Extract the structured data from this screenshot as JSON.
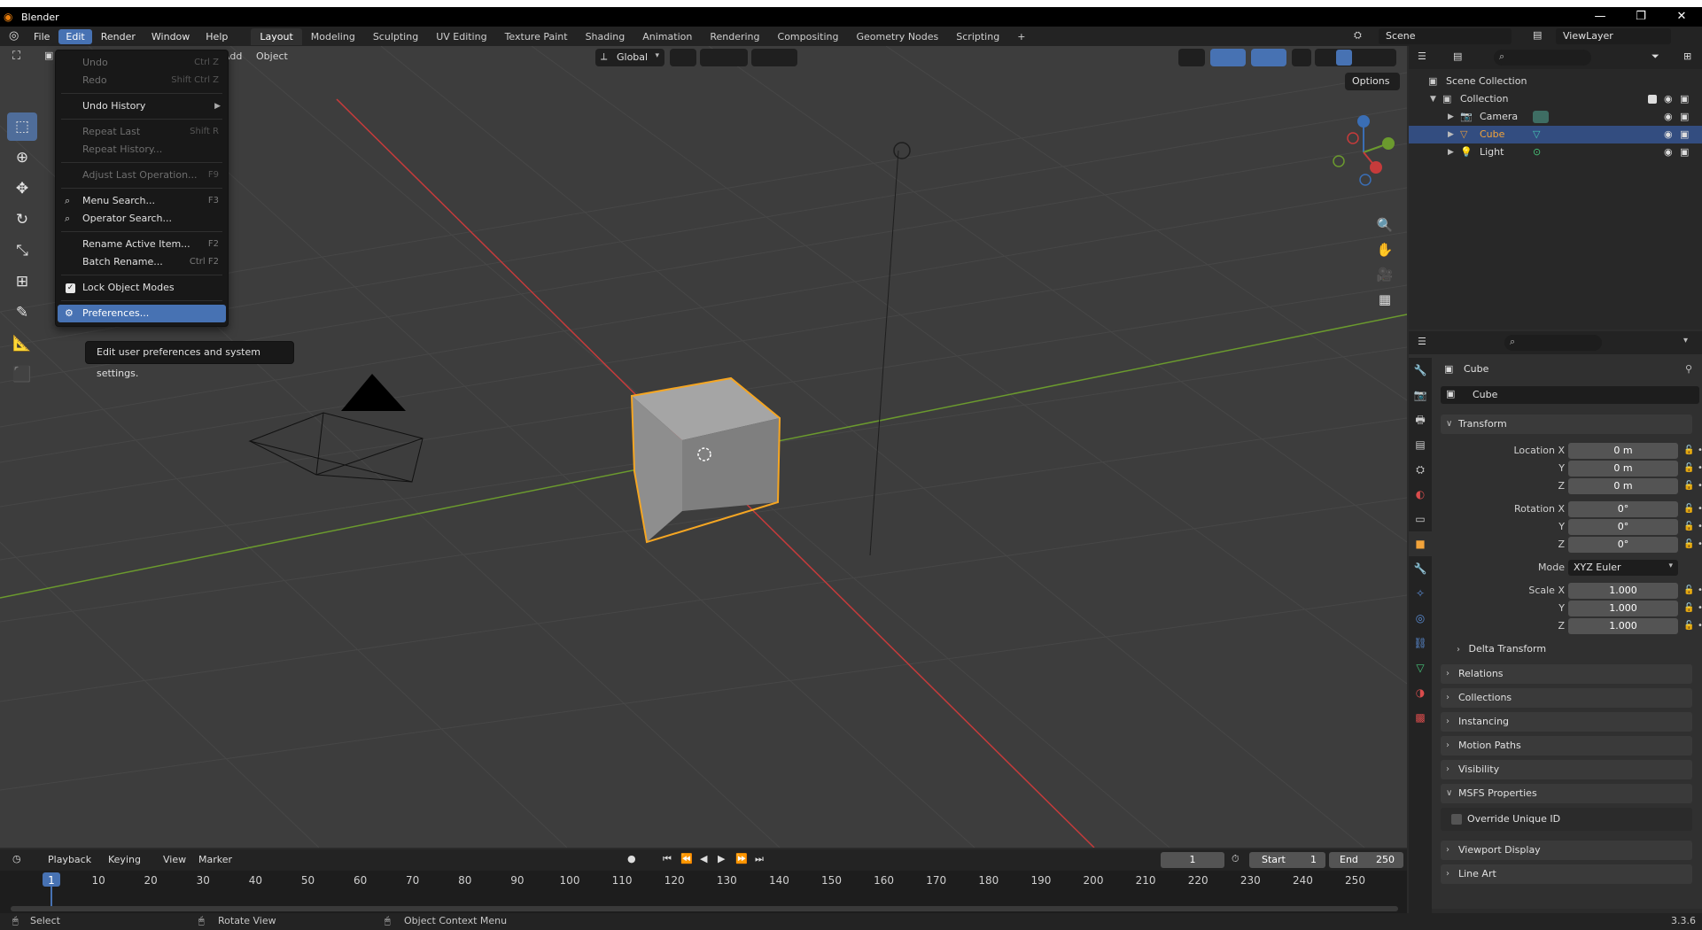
{
  "window": {
    "title": "Blender",
    "minimize": "—",
    "maximize": "❐",
    "close": "✕"
  },
  "menubar": {
    "file": "File",
    "edit": "Edit",
    "render": "Render",
    "window": "Window",
    "help": "Help"
  },
  "workspaces": [
    "Layout",
    "Modeling",
    "Sculpting",
    "UV Editing",
    "Texture Paint",
    "Shading",
    "Animation",
    "Rendering",
    "Compositing",
    "Geometry Nodes",
    "Scripting"
  ],
  "add_workspace": "+",
  "scene": {
    "name": "Scene",
    "view_layer": "ViewLayer"
  },
  "viewport": {
    "add_menu": "Add",
    "object_menu": "Object",
    "orientation": "Global",
    "options": "Options"
  },
  "edit_menu": {
    "undo": "Undo",
    "undo_sc": "Ctrl Z",
    "redo": "Redo",
    "redo_sc": "Shift Ctrl Z",
    "undo_history": "Undo History",
    "repeat_last": "Repeat Last",
    "repeat_last_sc": "Shift R",
    "repeat_history": "Repeat History...",
    "adjust_last": "Adjust Last Operation...",
    "adjust_last_sc": "F9",
    "menu_search": "Menu Search...",
    "menu_search_sc": "F3",
    "operator_search": "Operator Search...",
    "rename_active": "Rename Active Item...",
    "rename_active_sc": "F2",
    "batch_rename": "Batch Rename...",
    "batch_rename_sc": "Ctrl F2",
    "lock_object_modes": "Lock Object Modes",
    "preferences": "Preferences..."
  },
  "tooltip": "Edit user preferences and system settings.",
  "outliner": {
    "scene_collection": "Scene Collection",
    "collection": "Collection",
    "items": [
      "Camera",
      "Cube",
      "Light"
    ]
  },
  "properties": {
    "object_name": "Cube",
    "data_name": "Cube",
    "transform": "Transform",
    "location_x_label": "Location X",
    "y_label": "Y",
    "z_label": "Z",
    "location": [
      "0 m",
      "0 m",
      "0 m"
    ],
    "rotation_x_label": "Rotation X",
    "rotation": [
      "0°",
      "0°",
      "0°"
    ],
    "mode_label": "Mode",
    "mode_value": "XYZ Euler",
    "scale_x_label": "Scale X",
    "scale": [
      "1.000",
      "1.000",
      "1.000"
    ],
    "panels": [
      "Delta Transform",
      "Relations",
      "Collections",
      "Instancing",
      "Motion Paths",
      "Visibility",
      "MSFS Properties",
      "Viewport Display",
      "Line Art"
    ],
    "override_unique_id": "Override Unique ID"
  },
  "timeline": {
    "playback": "Playback",
    "keying": "Keying",
    "view": "View",
    "marker": "Marker",
    "current_frame": "1",
    "start_label": "Start",
    "start": "1",
    "end_label": "End",
    "end": "250",
    "ticks": [
      "1",
      "10",
      "20",
      "30",
      "40",
      "50",
      "60",
      "70",
      "80",
      "90",
      "100",
      "110",
      "120",
      "130",
      "140",
      "150",
      "160",
      "170",
      "180",
      "190",
      "200",
      "210",
      "220",
      "230",
      "240",
      "250"
    ]
  },
  "statusbar": {
    "select": "Select",
    "rotate": "Rotate View",
    "context": "Object Context Menu",
    "version": "3.3.6"
  },
  "colors": {
    "accent": "#4772b3",
    "selection_orange": "#f5a623",
    "x_axis": "#c63b3b",
    "y_axis": "#6b9a2e"
  }
}
